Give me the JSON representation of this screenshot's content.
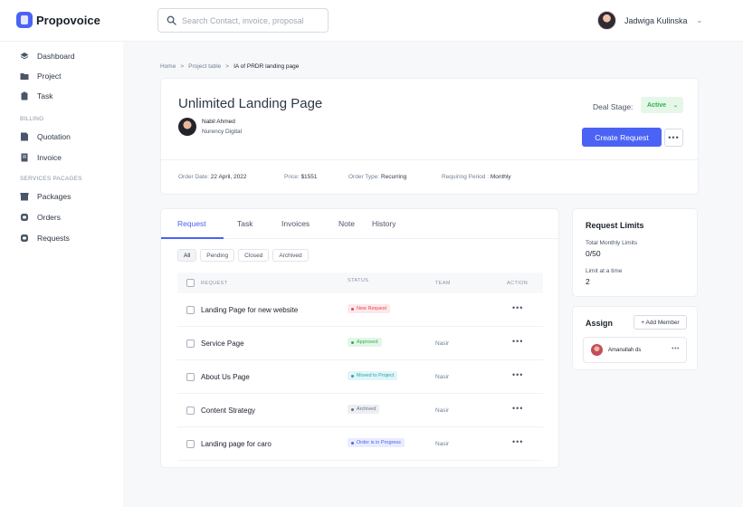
{
  "app": {
    "name": "Propovoice"
  },
  "search": {
    "placeholder": "Search Contact, invoice, proposal"
  },
  "user": {
    "name": "Jadwiga Kulinska"
  },
  "sidebar": {
    "items": [
      {
        "label": "Dashboard",
        "icon": "dashboard-icon"
      },
      {
        "label": "Project",
        "icon": "folder-icon"
      },
      {
        "label": "Task",
        "icon": "clipboard-icon"
      }
    ],
    "billing_heading": "BILLING",
    "billing_items": [
      {
        "label": "Quotation",
        "icon": "quotation-icon"
      },
      {
        "label": "Invoice",
        "icon": "invoice-icon"
      }
    ],
    "services_heading": "SERVICES PACAGES",
    "services_items": [
      {
        "label": "Packages",
        "icon": "package-icon"
      },
      {
        "label": "Orders",
        "icon": "orders-icon"
      },
      {
        "label": "Requests",
        "icon": "requests-icon"
      }
    ]
  },
  "breadcrumb": {
    "home": "Home",
    "sep": ">",
    "parent": "Project table",
    "current": "IA of PRDR landing page"
  },
  "project": {
    "title": "Unlimited Landing Page",
    "client_name": "Nabil Ahmed",
    "client_org": "Nurency Digital",
    "deal_stage_label": "Deal Stage:",
    "deal_stage_value": "Active",
    "create_request": "Create Request",
    "more": "•••",
    "order_date_label": "Order Date:",
    "order_date": "22 April, 2022",
    "price_label": "Price:",
    "price": "$1551",
    "order_type_label": "Order Type:",
    "order_type": "Recurring",
    "period_label": "Requiring Period :",
    "period": "Monthly"
  },
  "tabs": [
    "Request",
    "Task",
    "Invoices",
    "Note",
    "History"
  ],
  "filters": [
    "All",
    "Pending",
    "Closed",
    "Archived"
  ],
  "table": {
    "headers": {
      "request": "REQUEST",
      "status": "STATUS",
      "team": "TEAM",
      "action": "ACTION"
    },
    "rows": [
      {
        "name": "Landing Page for new website",
        "status": "New Request",
        "team": "",
        "action": "•••"
      },
      {
        "name": "Service Page",
        "status": "Approved",
        "team": "Nasir",
        "action": "•••"
      },
      {
        "name": "About Us Page",
        "status": "Moved to Project",
        "team": "Nasir",
        "action": "•••"
      },
      {
        "name": "Content Strategy",
        "status": "Archived",
        "team": "Nasir",
        "action": "•••"
      },
      {
        "name": "Landing page for caro",
        "status": "Order is in Progress",
        "team": "Nasir",
        "action": "•••"
      }
    ]
  },
  "status_colors": {
    "New Request": {
      "bg": "#fde8ec",
      "fg": "#e5484d"
    },
    "Approved": {
      "bg": "#e3f6e8",
      "fg": "#2bb14c"
    },
    "Moved to Project": {
      "bg": "#e2f5f7",
      "fg": "#1ea7b8"
    },
    "Archived": {
      "bg": "#eceef2",
      "fg": "#6b7385"
    },
    "Order is in Progress": {
      "bg": "#e8ecfe",
      "fg": "#4a63f4"
    }
  },
  "limits": {
    "title": "Request Limits",
    "monthly_label": "Total Monthly Limits",
    "monthly_value": "0/50",
    "time_label": "Limit at a time",
    "time_value": "2"
  },
  "assign": {
    "title": "Assign",
    "add_member": "+ Add Member",
    "member_name": "Amanullah ds",
    "member_more": "•••"
  },
  "colors": {
    "accent": "#4a63f4",
    "active_badge": "#2bb14c"
  }
}
